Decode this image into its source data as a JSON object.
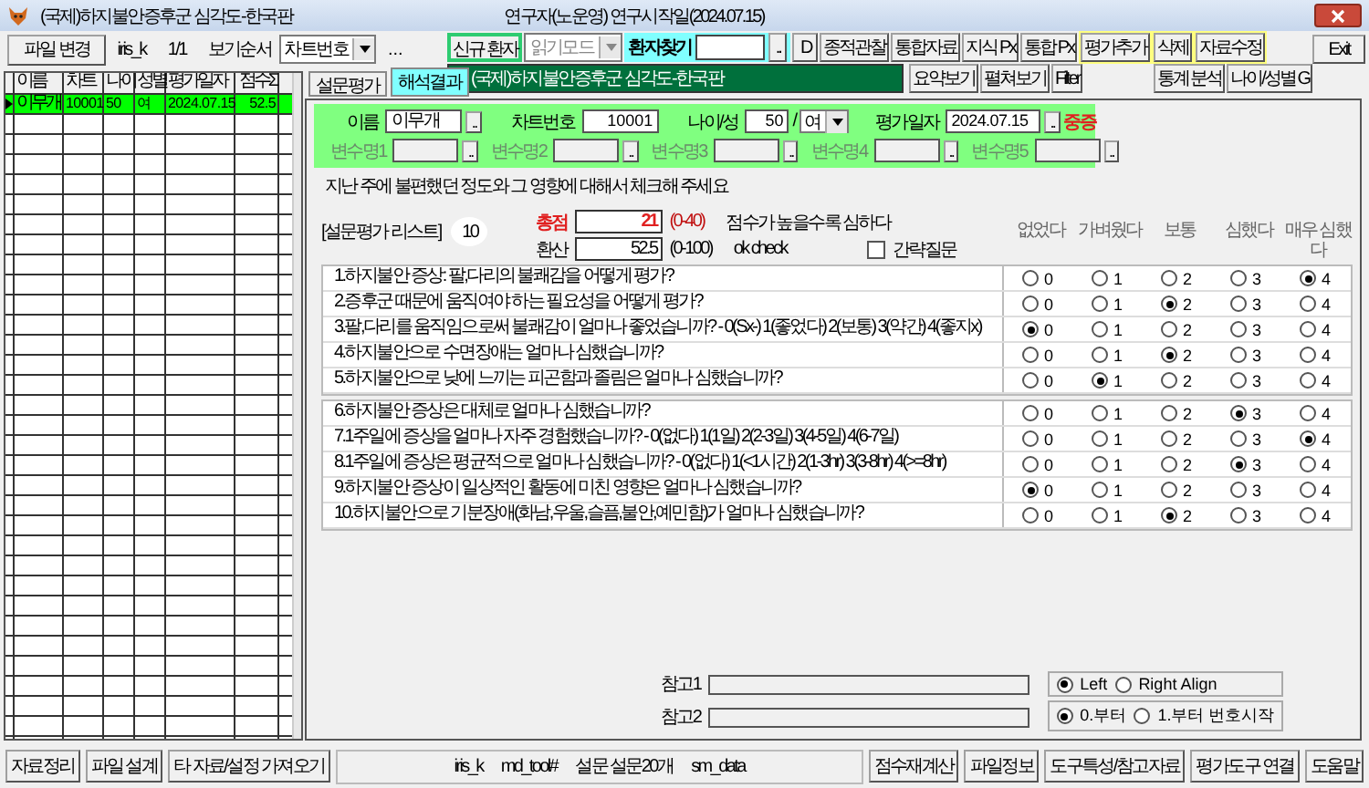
{
  "window": {
    "title": "(국제)하지불안증후군 심각도-한국판",
    "subtitle": "연구자(노운영) 연구시작일(2024.07.15)"
  },
  "toolbar": {
    "file_change": "파일 변경",
    "user": "iris_k",
    "page": "1/1",
    "sort_label": "보기순서",
    "sort_value": "차트번호",
    "more": "...",
    "new_patient": "신규 환자",
    "mode": "읽기모드",
    "find_label": "환자찾기",
    "find_button": "..",
    "d_button": "D",
    "row1_buttons": [
      "종적관찰",
      "통합자료",
      "지식 Px",
      "통합 Px"
    ],
    "edit_buttons": [
      "평가추가",
      "삭제",
      "자료수정"
    ],
    "banner": "(국제)하지불안증후군 심각도-한국판",
    "row2_buttons": [
      "요약보기",
      "펼쳐보기",
      "Filter"
    ],
    "row2_right_buttons": [
      "통계 분석",
      "나이/성별 G"
    ],
    "exit": "Exit"
  },
  "table": {
    "columns": [
      "이름",
      "차트",
      "나이",
      "성별",
      "평가일자",
      "점수Σ"
    ],
    "rows": [
      {
        "cells": [
          "이무개",
          "10001",
          "50",
          "여",
          "2024.07.15",
          "52.5"
        ],
        "selected": true
      }
    ]
  },
  "tabs": [
    {
      "label": "설문평가",
      "selected": false
    },
    {
      "label": "해석결과",
      "selected": true
    }
  ],
  "form": {
    "name_label": "이름",
    "name": "이무개",
    "chart_label": "차트번호",
    "chart": "10001",
    "age_label": "나이/성",
    "age": "50",
    "age_sex_separator": "/",
    "sex": "여",
    "date_label": "평가일자",
    "date": "2024.07.15",
    "severity": "중증",
    "browse": "..",
    "variables": [
      "변수명1",
      "변수명2",
      "변수명3",
      "변수명4",
      "변수명5"
    ]
  },
  "instruction": "지난 주에 불편했던 정도와 그 영향에 대해서 체크해 주세요",
  "list_label": "[설문평가 리스트]",
  "list_count": "10",
  "total": {
    "label": "총점",
    "value": "21",
    "range": "(0-40)",
    "note": "점수가 높을수록 심하다"
  },
  "converted": {
    "label": "환산",
    "value": "52.5",
    "range": "(0-100)",
    "note": "ok check"
  },
  "brief": {
    "label": "간략질문",
    "checked": false
  },
  "option_headers": [
    "없었다",
    "가벼웠다",
    "보통",
    "심했다",
    "매우 심했다"
  ],
  "question_groups": [
    [
      {
        "text": "1.하지불안 증상: 팔,다리의 불쾌감을 어떻게 평가?",
        "choices": [
          {
            "label": "0",
            "selected": false
          },
          {
            "label": "1",
            "selected": false
          },
          {
            "label": "2",
            "selected": false
          },
          {
            "label": "3",
            "selected": false
          },
          {
            "label": "4",
            "selected": true
          }
        ]
      },
      {
        "text": "2.증후군 때문에 움직여야 하는 필요성을 어떻게 평가?",
        "choices": [
          {
            "label": "0",
            "selected": false
          },
          {
            "label": "1",
            "selected": false
          },
          {
            "label": "2",
            "selected": true
          },
          {
            "label": "3",
            "selected": false
          },
          {
            "label": "4",
            "selected": false
          }
        ]
      },
      {
        "text": "3.팔,다리를 움직임으로써 불쾌감이 얼마나 좋었습니까? - 0(Sx-) 1(좋었다) 2(보통) 3(약간) 4(좋지x)",
        "choices": [
          {
            "label": "0",
            "selected": true
          },
          {
            "label": "1",
            "selected": false
          },
          {
            "label": "2",
            "selected": false
          },
          {
            "label": "3",
            "selected": false
          },
          {
            "label": "4",
            "selected": false
          }
        ]
      },
      {
        "text": "4.하지불안으로 수면장애는 얼마나 심했습니까?",
        "choices": [
          {
            "label": "0",
            "selected": false
          },
          {
            "label": "1",
            "selected": false
          },
          {
            "label": "2",
            "selected": true
          },
          {
            "label": "3",
            "selected": false
          },
          {
            "label": "4",
            "selected": false
          }
        ]
      },
      {
        "text": "5.하지불안으로 낮에 느끼는 피곤함과 졸림은 얼마나 심했습니까?",
        "choices": [
          {
            "label": "0",
            "selected": false
          },
          {
            "label": "1",
            "selected": true
          },
          {
            "label": "2",
            "selected": false
          },
          {
            "label": "3",
            "selected": false
          },
          {
            "label": "4",
            "selected": false
          }
        ]
      }
    ],
    [
      {
        "text": "6.하지불안 증상은 대체로 얼마나 심했습니까?",
        "choices": [
          {
            "label": "0",
            "selected": false
          },
          {
            "label": "1",
            "selected": false
          },
          {
            "label": "2",
            "selected": false
          },
          {
            "label": "3",
            "selected": true
          },
          {
            "label": "4",
            "selected": false
          }
        ]
      },
      {
        "text": "7.1주일에 증상을 얼마나 자주 경험했습니까?  - 0(없다) 1(1일) 2(2-3일) 3(4-5일) 4(6-7일)",
        "choices": [
          {
            "label": "0",
            "selected": false
          },
          {
            "label": "1",
            "selected": false
          },
          {
            "label": "2",
            "selected": false
          },
          {
            "label": "3",
            "selected": false
          },
          {
            "label": "4",
            "selected": true
          }
        ]
      },
      {
        "text": "8.1주일에 증상은 평균적으로 얼마나 심했습니까? - 0(없다) 1(<1시간) 2(1-3hr) 3(3-8hr) 4(>=8hr)",
        "choices": [
          {
            "label": "0",
            "selected": false
          },
          {
            "label": "1",
            "selected": false
          },
          {
            "label": "2",
            "selected": false
          },
          {
            "label": "3",
            "selected": true
          },
          {
            "label": "4",
            "selected": false
          }
        ]
      },
      {
        "text": "9.하지불안 증상이 일상적인 활동에 미친 영향은 얼마나 심했습니까?",
        "choices": [
          {
            "label": "0",
            "selected": true
          },
          {
            "label": "1",
            "selected": false
          },
          {
            "label": "2",
            "selected": false
          },
          {
            "label": "3",
            "selected": false
          },
          {
            "label": "4",
            "selected": false
          }
        ]
      },
      {
        "text": "10.하지불안으로 기분장애(화남,우울,슬픔,불안,예민함)가 얼마나 심했습니까?",
        "choices": [
          {
            "label": "0",
            "selected": false
          },
          {
            "label": "1",
            "selected": false
          },
          {
            "label": "2",
            "selected": true
          },
          {
            "label": "3",
            "selected": false
          },
          {
            "label": "4",
            "selected": false
          }
        ]
      }
    ]
  ],
  "notes": [
    "참고1",
    "참고2"
  ],
  "align_options": [
    {
      "label": "Left",
      "selected": true
    },
    {
      "label": "Right Align",
      "selected": false
    }
  ],
  "numbering_options": [
    {
      "label": "0.부터",
      "selected": true
    },
    {
      "label": "1.부터 번호시작",
      "selected": false
    }
  ],
  "footer": {
    "left_buttons": [
      "자료정리",
      "파일 설계",
      "타 자료/설정 가져오기"
    ],
    "status": [
      "iris_k",
      "md_tool#",
      "설문 설문20개",
      "sm_data"
    ],
    "right_buttons": [
      "점수재계산",
      "파일정보",
      "도구특성/참고자료",
      "평가도구 연결",
      "도움말"
    ]
  }
}
